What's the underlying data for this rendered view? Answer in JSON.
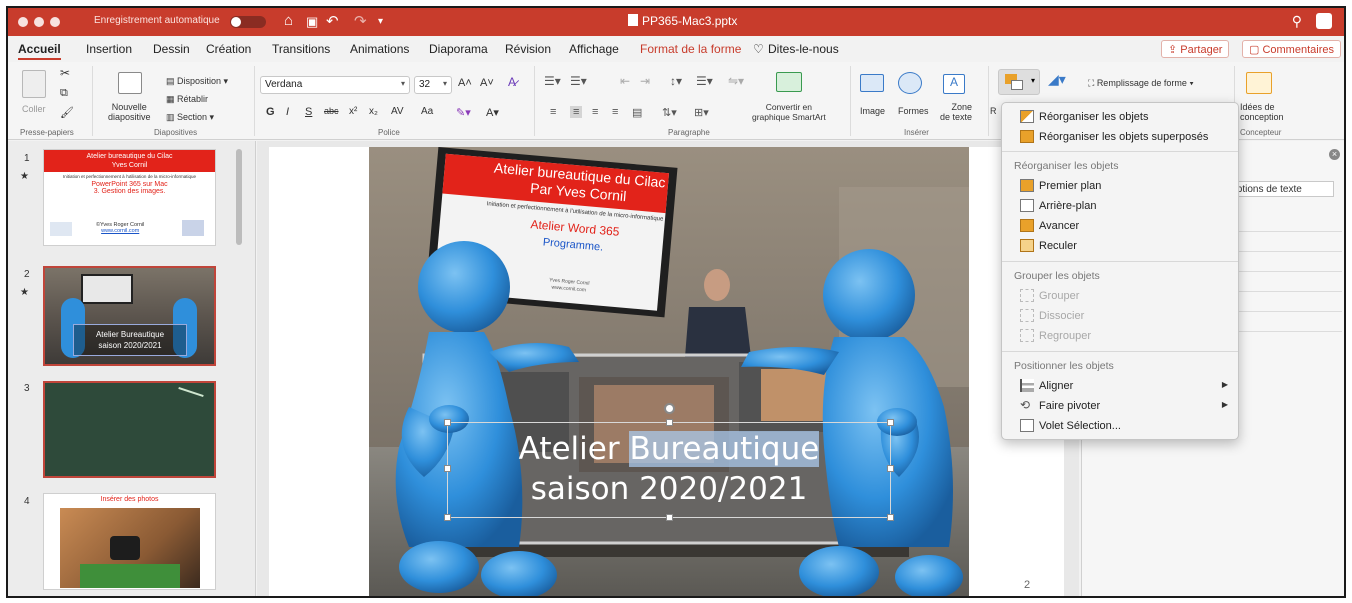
{
  "titlebar": {
    "autosave_label": "Enregistrement automatique",
    "toggle_state": "off",
    "doc_title": "PP365-Mac3.pptx"
  },
  "tabs": [
    "Accueil",
    "Insertion",
    "Dessin",
    "Création",
    "Transitions",
    "Animations",
    "Diaporama",
    "Révision",
    "Affichage",
    "Format de la forme",
    "Dites-le-nous"
  ],
  "share_label": "Partager",
  "comments_label": "Commentaires",
  "ribbon": {
    "paste": "Coller",
    "clipboard_group": "Presse-papiers",
    "new_slide_1": "Nouvelle",
    "new_slide_2": "diapositive",
    "layout": "Disposition",
    "reset": "Rétablir",
    "section": "Section",
    "slides_group": "Diapositives",
    "font_name": "Verdana",
    "font_size": "32",
    "font_group": "Police",
    "para_group": "Paragraphe",
    "convert_1": "Convertir en",
    "convert_2": "graphique SmartArt",
    "image": "Image",
    "shapes": "Formes",
    "textbox_1": "Zone",
    "textbox_2": "de texte",
    "insert_group": "Insérer",
    "fill": "Remplissage de forme",
    "ideas_1": "Idées de",
    "ideas_2": "conception",
    "designer_group": "Concepteur",
    "bold": "G",
    "italic": "I",
    "underline": "S",
    "strike": "abc",
    "super": "x²",
    "sub": "x₂",
    "spacing": "AV",
    "case": "Aa"
  },
  "slides": [
    {
      "num": "1",
      "title1": "Atelier bureautique du Cilac",
      "title2": "Yves Cornil",
      "l1": "Initiation et perfectionnement à l'utilisation de la micro-informatique",
      "l2": "PowerPoint 365 sur Mac",
      "l3": "3. Gestion des images.",
      "author": "©Yves Roger Cornil",
      "site": "www.cornil.com"
    },
    {
      "num": "2",
      "t1": "Atelier Bureautique",
      "t2": "saison 2020/2021"
    },
    {
      "num": "3"
    },
    {
      "num": "4",
      "title": "Insérer des photos"
    }
  ],
  "slide_main": {
    "screen_title1": "Atelier bureautique du Cilac",
    "screen_title2": "Par Yves Cornil",
    "screen_sub": "Initiation et perfectionnement à l'utilisation de la micro-informatique",
    "screen_word": "Atelier Word 365",
    "screen_prog": "Programme.",
    "screen_footer1": "Yves Roger Cornil",
    "screen_footer2": "www.cornil.com",
    "text_line1_a": "Atelier ",
    "text_line1_b": "Bureautique",
    "text_line2": "saison 2020/2021",
    "page_number": "2"
  },
  "right_pane": {
    "text_options": "Options de texte"
  },
  "menu": {
    "item1": "Réorganiser les objets",
    "item2": "Réorganiser les objets superposés",
    "h1": "Réorganiser les objets",
    "front": "Premier plan",
    "back": "Arrière-plan",
    "forward": "Avancer",
    "backward": "Reculer",
    "h2": "Grouper les objets",
    "group": "Grouper",
    "ungroup": "Dissocier",
    "regroup": "Regrouper",
    "h3": "Positionner les objets",
    "align": "Aligner",
    "rotate": "Faire pivoter",
    "selection": "Volet Sélection..."
  },
  "colors": {
    "accent": "#c83c2c",
    "selection": "#0a5fd8",
    "figure": "#2f8fdb"
  }
}
